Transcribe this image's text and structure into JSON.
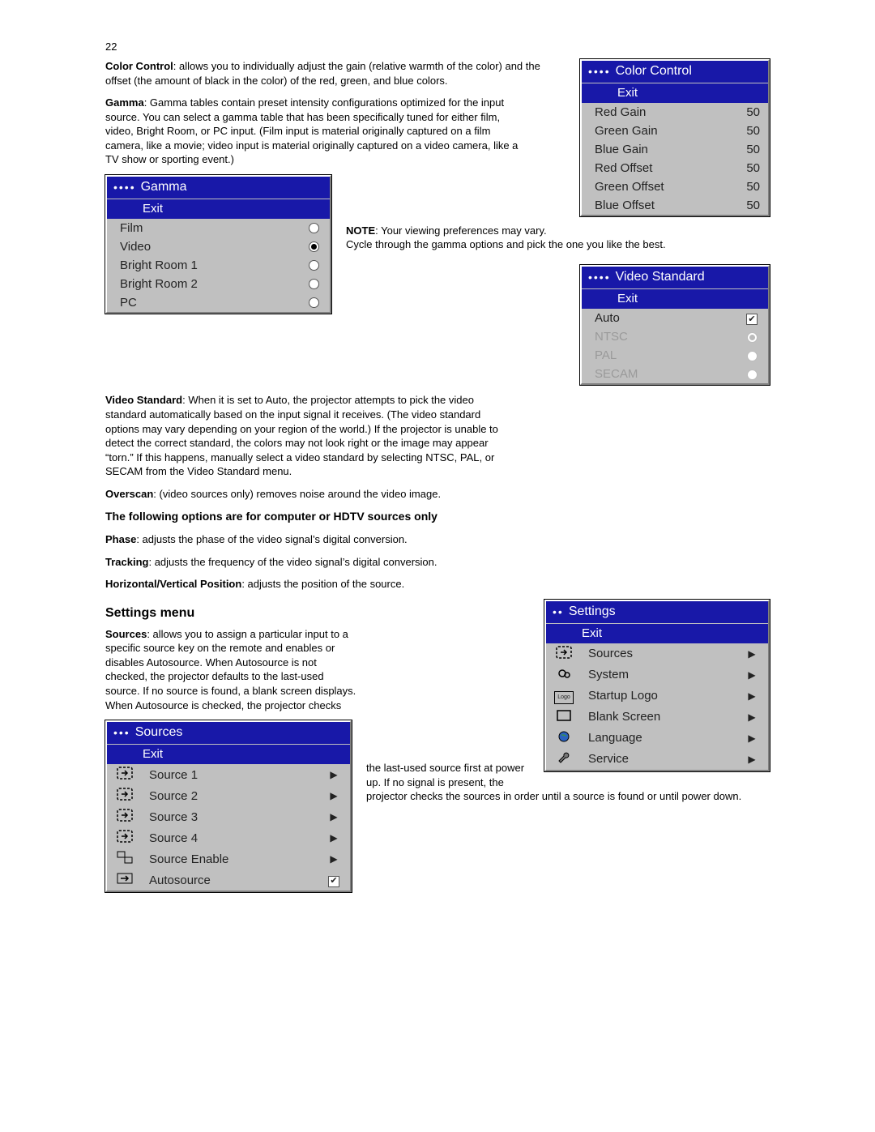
{
  "page_number": "22",
  "paragraphs": {
    "color_control_label": "Color Control",
    "color_control_text": ": allows you to individually adjust the gain (relative warmth of the color) and the offset (the amount of black in the color) of the red, green, and blue colors.",
    "gamma_label": "Gamma",
    "gamma_text": ": Gamma tables contain preset intensity configurations optimized for the input source. You can select a gamma table that has been specifically tuned for either film, video, Bright Room, or PC input. (Film input is material originally captured on a film camera, like a movie; video input is material originally captured on a video camera, like a TV show or sporting event.)",
    "note_label": "NOTE",
    "note_text": ": Your viewing preferences may vary. Cycle through the gamma options and pick the one you like the best.",
    "video_std_label": "Video Standard",
    "video_std_text": ": When it is set to Auto, the projector attempts to pick the video standard automatically based on the input signal it receives. (The video standard options may vary depending on your region of the world.) If the projector is unable to detect the correct standard, the colors may not look right or the image may appear “torn.” If this happens, manually select a video standard by selecting NTSC, PAL, or SECAM from the Video Standard menu.",
    "overscan_label": "Overscan",
    "overscan_text": ": (video sources only) removes noise around the video image.",
    "hdtv_heading": "The following options are for computer or HDTV sources only",
    "phase_label": "Phase",
    "phase_text": ": adjusts the phase of the video signal’s digital conversion.",
    "tracking_label": "Tracking",
    "tracking_text": ": adjusts the frequency of the video signal’s digital conversion.",
    "hvpos_label": "Horizontal/Vertical Position",
    "hvpos_text": ": adjusts the position of the source.",
    "settings_heading": "Settings menu",
    "sources_label": "Sources",
    "sources_text_1": ": allows you to assign a particular input to a specific source key on the remote and enables or disables Autosource. When Autosource is not checked, the projector defaults to the last-used source. If no source is found, a blank screen displays. When Autosource is checked, the projector checks",
    "sources_text_2": "the last-used source first at power up. If no signal is present, the projector checks the sources in order until a source is found or until power down."
  },
  "osd": {
    "exit_label": "Exit",
    "color_control": {
      "title": "Color Control",
      "dots": "••••",
      "rows": [
        {
          "label": "Red Gain",
          "value": "50"
        },
        {
          "label": "Green Gain",
          "value": "50"
        },
        {
          "label": "Blue Gain",
          "value": "50"
        },
        {
          "label": "Red Offset",
          "value": "50"
        },
        {
          "label": "Green Offset",
          "value": "50"
        },
        {
          "label": "Blue Offset",
          "value": "50"
        }
      ]
    },
    "gamma": {
      "title": "Gamma",
      "dots": "••••",
      "rows": [
        {
          "label": "Film",
          "selected": false
        },
        {
          "label": "Video",
          "selected": true
        },
        {
          "label": "Bright Room 1",
          "selected": false
        },
        {
          "label": "Bright Room 2",
          "selected": false
        },
        {
          "label": "PC",
          "selected": false
        }
      ]
    },
    "video_standard": {
      "title": "Video Standard",
      "dots": "••••",
      "rows": [
        {
          "label": "Auto",
          "type": "check",
          "checked": true,
          "enabled": true
        },
        {
          "label": "NTSC",
          "type": "radio",
          "checked": true,
          "enabled": false
        },
        {
          "label": "PAL",
          "type": "radio",
          "checked": false,
          "enabled": false
        },
        {
          "label": "SECAM",
          "type": "radio",
          "checked": false,
          "enabled": false
        }
      ]
    },
    "settings": {
      "title": "Settings",
      "dots": "••",
      "rows": [
        {
          "label": "Sources",
          "icon": "input"
        },
        {
          "label": "System",
          "icon": "gear"
        },
        {
          "label": "Startup Logo",
          "icon": "logo"
        },
        {
          "label": "Blank Screen",
          "icon": "rect"
        },
        {
          "label": "Language",
          "icon": "globe"
        },
        {
          "label": "Service",
          "icon": "wrench"
        }
      ]
    },
    "sources": {
      "title": "Sources",
      "dots": "•••",
      "rows": [
        {
          "label": "Source 1",
          "icon": "input",
          "ctrl": "arrow"
        },
        {
          "label": "Source 2",
          "icon": "input",
          "ctrl": "arrow"
        },
        {
          "label": "Source 3",
          "icon": "input",
          "ctrl": "arrow"
        },
        {
          "label": "Source 4",
          "icon": "input",
          "ctrl": "arrow"
        },
        {
          "label": "Source Enable",
          "icon": "enable",
          "ctrl": "arrow"
        },
        {
          "label": "Autosource",
          "icon": "auto",
          "ctrl": "check"
        }
      ]
    }
  }
}
